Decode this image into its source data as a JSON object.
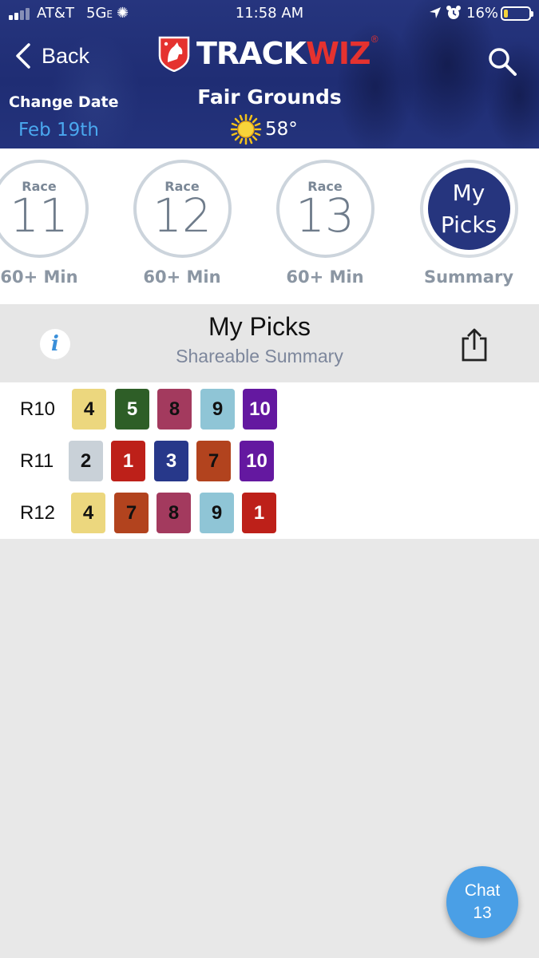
{
  "status_bar": {
    "carrier": "AT&T",
    "network": "5G",
    "network_suffix": "E",
    "time": "11:58 AM",
    "battery": "16%",
    "battery_level": 0.16
  },
  "nav": {
    "back_label": "Back",
    "logo_part1": "TRACK",
    "logo_part2": "WIZ",
    "logo_reg": "®"
  },
  "track": {
    "change_date_label": "Change Date",
    "date": "Feb 19th",
    "name": "Fair Grounds",
    "temperature": "58°",
    "weather_icon": "sun-icon"
  },
  "races": [
    {
      "label": "Race",
      "number": "11",
      "time": "60+ Min"
    },
    {
      "label": "Race",
      "number": "12",
      "time": "60+ Min"
    },
    {
      "label": "Race",
      "number": "13",
      "time": "60+ Min"
    },
    {
      "label_line1": "My",
      "label_line2": "Picks",
      "time": "Summary",
      "selected": true
    }
  ],
  "picks_header": {
    "title": "My Picks",
    "subtitle": "Shareable Summary"
  },
  "picks": [
    {
      "race": "R10",
      "chips": [
        {
          "num": "4",
          "bg": "#ecd77e",
          "fg": "#111111"
        },
        {
          "num": "5",
          "bg": "#2e5e27",
          "fg": "#ffffff"
        },
        {
          "num": "8",
          "bg": "#a33a5e",
          "fg": "#111111"
        },
        {
          "num": "9",
          "bg": "#8fc5d6",
          "fg": "#111111"
        },
        {
          "num": "10",
          "bg": "#6418a0",
          "fg": "#ffffff"
        }
      ]
    },
    {
      "race": "R11",
      "chips": [
        {
          "num": "2",
          "bg": "#c9d1d8",
          "fg": "#111111"
        },
        {
          "num": "1",
          "bg": "#bd2019",
          "fg": "#ffffff"
        },
        {
          "num": "3",
          "bg": "#27388a",
          "fg": "#ffffff"
        },
        {
          "num": "7",
          "bg": "#b2431e",
          "fg": "#111111"
        },
        {
          "num": "10",
          "bg": "#6418a0",
          "fg": "#ffffff"
        }
      ]
    },
    {
      "race": "R12",
      "chips": [
        {
          "num": "4",
          "bg": "#ecd77e",
          "fg": "#111111"
        },
        {
          "num": "7",
          "bg": "#b2431e",
          "fg": "#111111"
        },
        {
          "num": "8",
          "bg": "#a33a5e",
          "fg": "#111111"
        },
        {
          "num": "9",
          "bg": "#8fc5d6",
          "fg": "#111111"
        },
        {
          "num": "1",
          "bg": "#bd2019",
          "fg": "#ffffff"
        }
      ]
    }
  ],
  "chat": {
    "label": "Chat",
    "count": "13"
  }
}
